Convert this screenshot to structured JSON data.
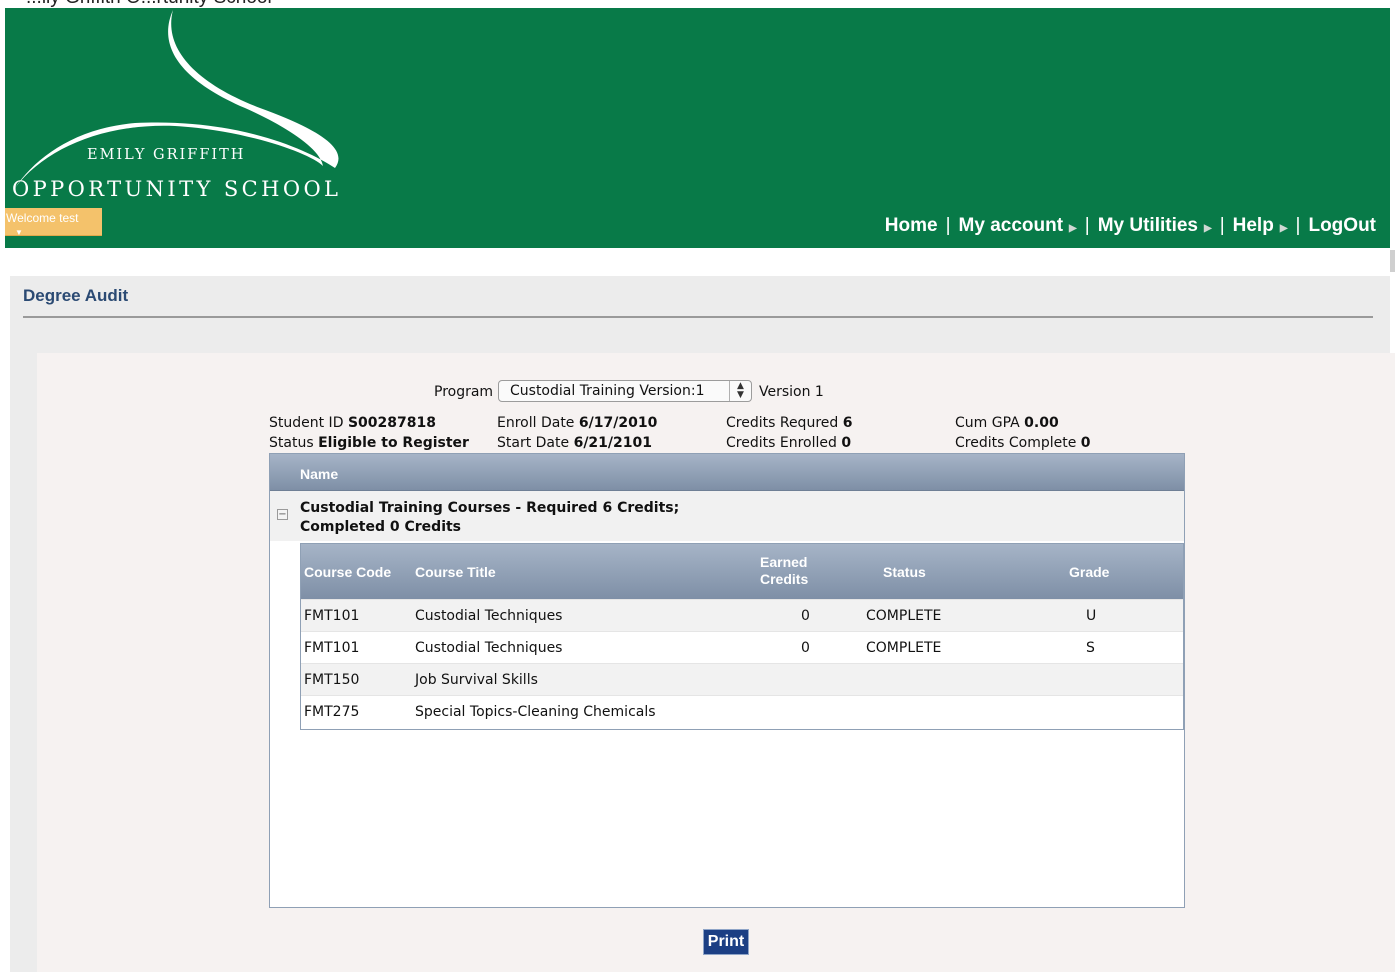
{
  "top_fragment": "...ily Griffith O...rtunity School",
  "header": {
    "logo_line1": "EMILY GRIFFITH",
    "logo_line2": "OPPORTUNITY SCHOOL",
    "welcome": "Welcome test",
    "nav": {
      "home": "Home",
      "my_account": "My account",
      "my_utilities": "My Utilities",
      "help": "Help",
      "logout": "LogOut",
      "separator": "|"
    }
  },
  "page": {
    "title": "Degree Audit"
  },
  "program": {
    "label": "Program",
    "selected": "Custodial Training Version:1",
    "version": "Version 1"
  },
  "student": {
    "id_label": "Student ID",
    "id_value": "S00287818",
    "status_label": "Status",
    "status_value": "Eligible to Register",
    "enroll_label": "Enroll Date",
    "enroll_value": "6/17/2010",
    "start_label": "Start Date",
    "start_value": "6/21/2101",
    "credits_required_label": "Credits Requred",
    "credits_required_value": "6",
    "credits_enrolled_label": "Credits Enrolled",
    "credits_enrolled_value": "0",
    "gpa_label": "Cum GPA",
    "gpa_value": "0.00",
    "credits_complete_label": "Credits Complete",
    "credits_complete_value": "0"
  },
  "grid": {
    "header": "Name",
    "group_title": "Custodial Training Courses - Required 6 Credits; Completed 0 Credits",
    "toggle": "−",
    "columns": {
      "code": "Course Code",
      "title": "Course Title",
      "earned_line1": "Earned",
      "earned_line2": "Credits",
      "status": "Status",
      "grade": "Grade"
    },
    "rows": [
      {
        "code": "FMT101",
        "title": "Custodial Techniques",
        "earned": "0",
        "status": "COMPLETE",
        "grade": "U"
      },
      {
        "code": "FMT101",
        "title": "Custodial Techniques",
        "earned": "0",
        "status": "COMPLETE",
        "grade": "S"
      },
      {
        "code": "FMT150",
        "title": "Job Survival Skills",
        "earned": "",
        "status": "",
        "grade": ""
      },
      {
        "code": "FMT275",
        "title": "Special Topics-Cleaning Chemicals",
        "earned": "",
        "status": "",
        "grade": ""
      }
    ]
  },
  "print_label": "Print",
  "colors": {
    "header_green": "#087a48",
    "title_blue": "#2b4a73",
    "grid_header": "#8c9cb1",
    "print_button": "#1c3f84",
    "welcome_tab": "#f4c26b"
  }
}
